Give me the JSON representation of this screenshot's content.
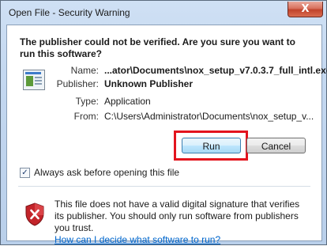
{
  "window": {
    "title": "Open File - Security Warning",
    "close_symbol": "X"
  },
  "question": "The publisher could not be verified.  Are you sure you want to run this software?",
  "fields": {
    "name_label": "Name:",
    "name_value": "...ator\\Documents\\nox_setup_v7.0.3.7_full_intl.exe",
    "publisher_label": "Publisher:",
    "publisher_value": "Unknown Publisher",
    "type_label": "Type:",
    "type_value": "Application",
    "from_label": "From:",
    "from_value": "C:\\Users\\Administrator\\Documents\\nox_setup_v..."
  },
  "buttons": {
    "run": "Run",
    "cancel": "Cancel"
  },
  "checkbox": {
    "checked": true,
    "label": "Always ask before opening this file"
  },
  "warning": {
    "text": "This file does not have a valid digital signature that verifies its publisher.  You should only run software from publishers you trust.",
    "link": "How can I decide what software to run?"
  },
  "icons": {
    "file": "application-file-icon",
    "shield": "security-shield-error-icon"
  },
  "colors": {
    "highlight": "#e3141e",
    "link": "#0066cc"
  }
}
